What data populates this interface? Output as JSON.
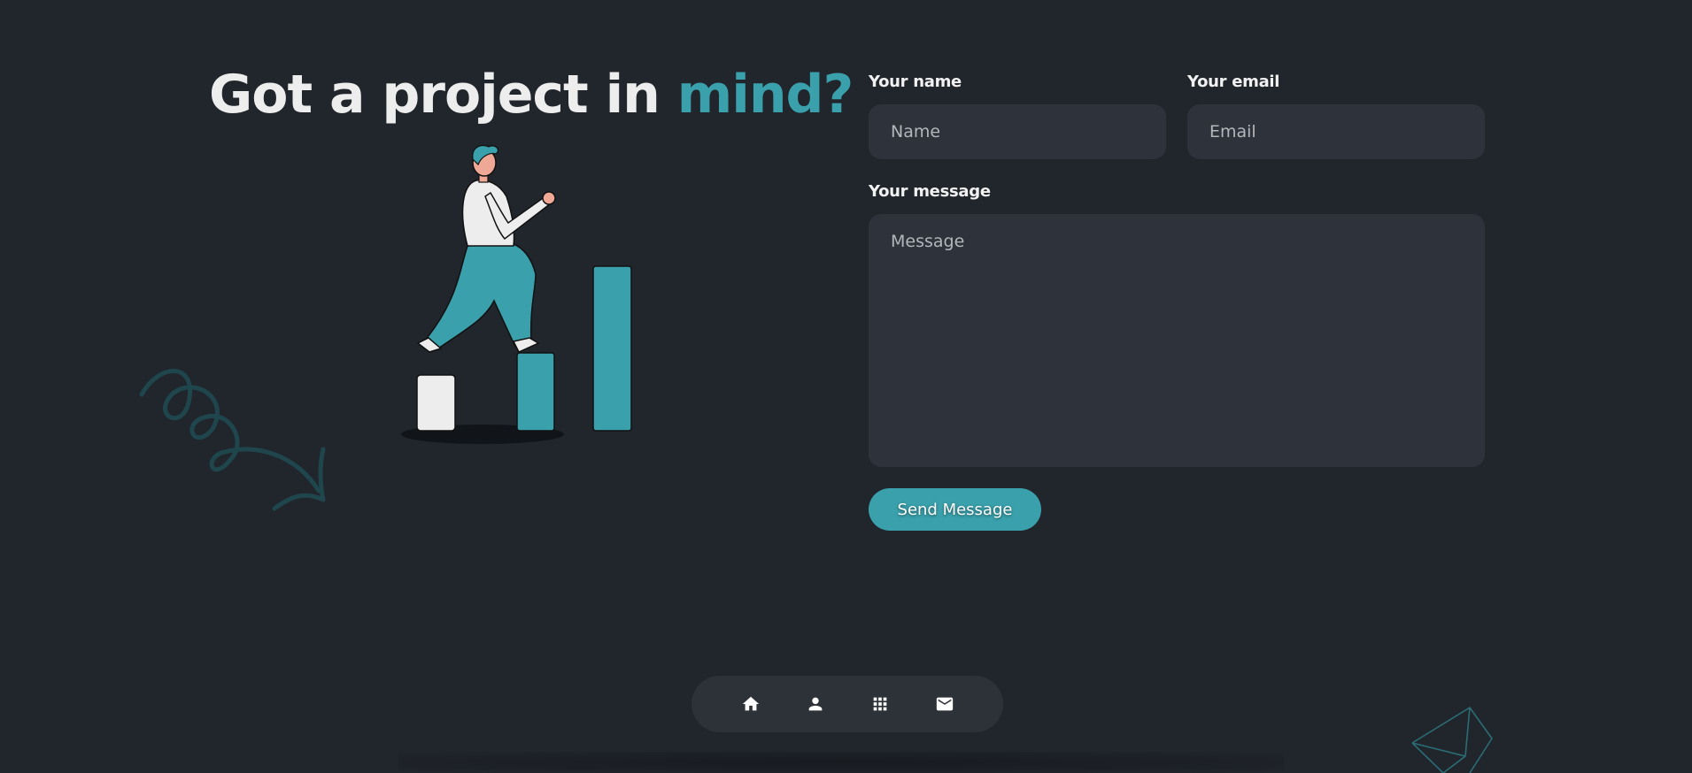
{
  "heading": {
    "text_main": "Got a project in ",
    "text_accent": "mind?"
  },
  "form": {
    "name_label": "Your name",
    "name_placeholder": "Name",
    "email_label": "Your email",
    "email_placeholder": "Email",
    "message_label": "Your message",
    "message_placeholder": "Message",
    "submit_label": "Send Message"
  },
  "nav": {
    "items": [
      {
        "icon": "home-icon"
      },
      {
        "icon": "person-icon"
      },
      {
        "icon": "grid-icon"
      },
      {
        "icon": "mail-icon"
      }
    ]
  },
  "colors": {
    "background": "#21252c",
    "accent": "#3aa1ac",
    "field_background": "#2e323a",
    "text": "#ededed"
  }
}
